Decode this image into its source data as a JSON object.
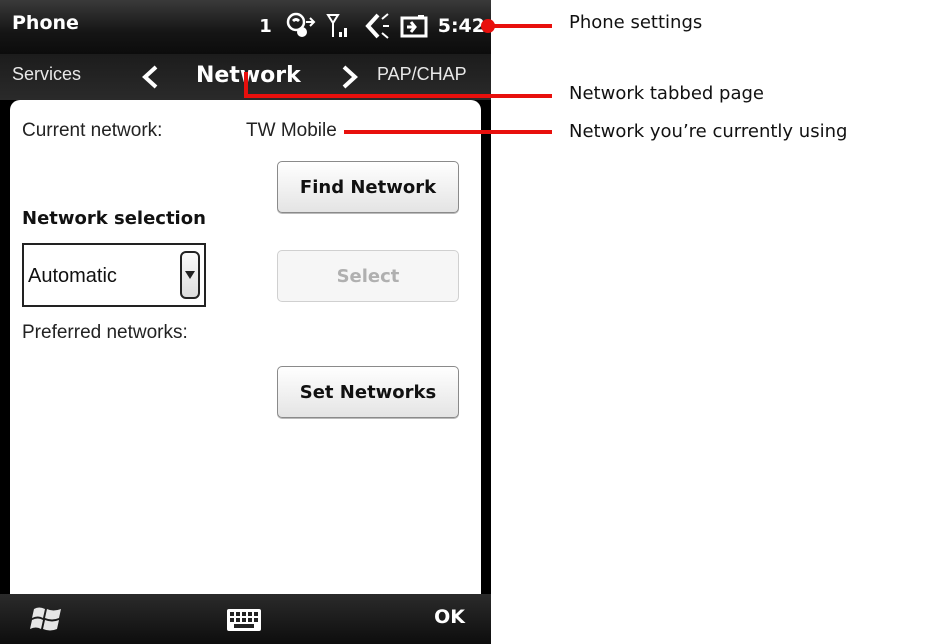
{
  "status_bar": {
    "title": "Phone",
    "notification_count": "1",
    "icons": [
      "phone-forward-icon",
      "signal-icon",
      "volume-icon",
      "battery-charging-icon"
    ],
    "time": "5:42"
  },
  "tabs": {
    "previous": "Services",
    "current": "Network",
    "next": "PAP/CHAP"
  },
  "content": {
    "current_network_label": "Current network:",
    "current_network_value": "TW Mobile",
    "find_network_button": "Find Network",
    "network_selection_heading": "Network selection",
    "network_selection_value": "Automatic",
    "select_button": "Select",
    "preferred_networks_label": "Preferred networks:",
    "set_networks_button": "Set Networks"
  },
  "softkeys": {
    "start_icon": "windows-flag-icon",
    "keyboard_icon": "keyboard-icon",
    "ok": "OK"
  },
  "annotations": {
    "phone_settings": "Phone settings",
    "network_tab": "Network tabbed page",
    "current_network": "Network you’re currently using"
  },
  "colors": {
    "annotation": "#e8100d",
    "status_bar": "#151515",
    "content_background": "#ffffff"
  }
}
